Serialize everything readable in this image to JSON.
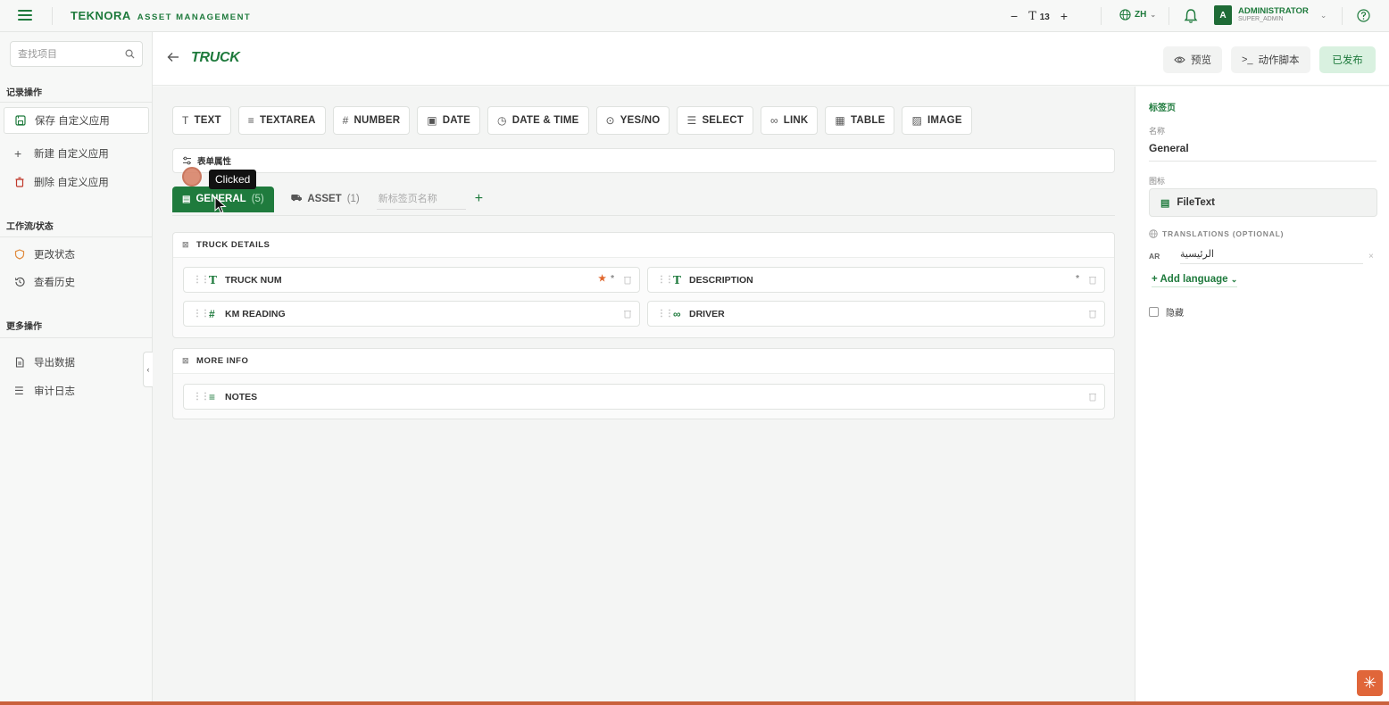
{
  "topbar": {
    "brand_name": "TEKNORA",
    "brand_sub": "ASSET MANAGEMENT",
    "font_minus": "−",
    "font_size": "13",
    "font_plus": "+",
    "language": "ZH",
    "user_initial": "A",
    "user_name": "ADMINISTRATOR",
    "user_role": "SUPER_ADMIN"
  },
  "sidebar": {
    "search_placeholder": "查找项目",
    "section_record": "记录操作",
    "save_label": "保存 自定义应用",
    "new_label": "新建 自定义应用",
    "delete_label": "删除 自定义应用",
    "section_workflow": "工作流/状态",
    "change_status_label": "更改状态",
    "history_label": "查看历史",
    "section_more": "更多操作",
    "export_label": "导出数据",
    "audit_label": "审计日志"
  },
  "header": {
    "title": "TRUCK",
    "preview_label": "预览",
    "script_label": "动作脚本",
    "publish_label": "已发布"
  },
  "field_types": [
    {
      "icon": "T",
      "label": "TEXT"
    },
    {
      "icon": "≡",
      "label": "TEXTAREA"
    },
    {
      "icon": "#",
      "label": "NUMBER"
    },
    {
      "icon": "▣",
      "label": "DATE"
    },
    {
      "icon": "◷",
      "label": "DATE & TIME"
    },
    {
      "icon": "⊙",
      "label": "YES/NO"
    },
    {
      "icon": "☰",
      "label": "SELECT"
    },
    {
      "icon": "∞",
      "label": "LINK"
    },
    {
      "icon": "▦",
      "label": "TABLE"
    },
    {
      "icon": "▨",
      "label": "IMAGE"
    }
  ],
  "form_props_label": "表单属性",
  "tabs": {
    "general_label": "GENERAL",
    "general_count": "(5)",
    "asset_label": "ASSET",
    "asset_count": "(1)",
    "new_tab_placeholder": "新标签页名称",
    "add_symbol": "+"
  },
  "tooltip": "Clicked",
  "sections": {
    "truck_details": {
      "title": "TRUCK DETAILS",
      "fields": {
        "truck_num": "TRUCK NUM",
        "description": "DESCRIPTION",
        "km_reading": "KM READING",
        "driver": "DRIVER"
      }
    },
    "more_info": {
      "title": "MORE INFO",
      "fields": {
        "notes": "NOTES"
      }
    }
  },
  "right_panel": {
    "title": "标签页",
    "name_label": "名称",
    "name_value": "General",
    "icon_label": "图标",
    "icon_value": "FileText",
    "translations_label": "TRANSLATIONS (OPTIONAL)",
    "ar_code": "AR",
    "ar_value": "الرئيسية",
    "add_language": "+ Add language",
    "hide_label": "隐藏"
  },
  "colors": {
    "accent": "#1e7a3c",
    "active_tab": "#1f7b3d",
    "publish_bg": "#d9f1e0",
    "required_star": "#e0662c",
    "assistant": "#e0663a"
  }
}
